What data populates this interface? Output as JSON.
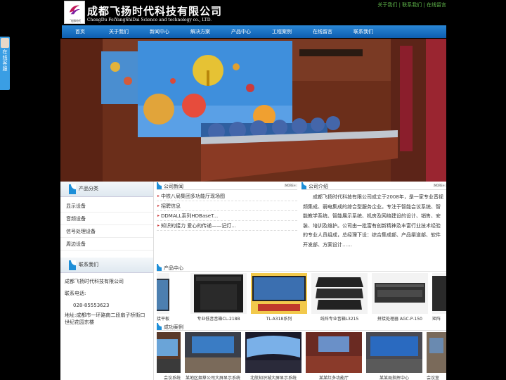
{
  "header": {
    "logo_small_text": "飞扬时代",
    "company_name": "成都飞扬时代科技有限公司",
    "company_en": "ChengDu FeiYangShiDai Science and technology co., LTD.",
    "top_links": "关于我们 | 联系我们 | 在线留言"
  },
  "nav": [
    "首页",
    "关于我们",
    "新闻中心",
    "解决方案",
    "产品中心",
    "工程案例",
    "在线留言",
    "联系我们"
  ],
  "side_float": {
    "label": "在线客服"
  },
  "left": {
    "product_category_title": "产品分类",
    "categories": [
      "显示设备",
      "音频设备",
      "信号处理设备",
      "周边设备"
    ],
    "contact_title": "联系我们",
    "contact_company": "成都飞扬时代科技有限公司",
    "contact_phone_label": "联系电话:",
    "contact_phone": "028-85553623",
    "contact_address": "地址:成都市一环路南二段扇子桥街口世纪花园东楼"
  },
  "news": {
    "title": "公司新闻",
    "more": "MORE+",
    "items": [
      "中铁八局集团多功能厅现场图",
      "招聘信息",
      "DDMALL系列HDBaseT...",
      "知识的接力 爱心的传递——记灯..."
    ]
  },
  "intro": {
    "title": "公司介绍",
    "more": "MORE+",
    "text": "成都飞扬时代科技有限公司成立于2008年，是一家专业音视频集成、弱电集成的综合型服务企业。专注于智能会议系统、智能教学系统、智能展示系统、机房及网络建设的设计、销售、安装、培训及维护。公司由一批富有创新精神及丰富行业技术经验的专业人员组成，总经理下设：综合集成部、产品渠道部、软件开发部、方案设计……"
  },
  "products": {
    "title": "产品中心",
    "items": [
      "液晶拼接平板",
      "专业低音音箱CL-218B",
      "TL-A318系列",
      "线阵专业音箱L3215",
      "拼接处理器 AGC-P-150",
      "矩阵"
    ]
  },
  "cases": {
    "title": "成功案例",
    "items": [
      "会议系统",
      "某地区烟草公司大屏显示系统",
      "北航知识城大屏显示系统",
      "某某红多功能厅",
      "某某局指挥中心",
      "会议室"
    ]
  },
  "colors": {
    "nav": "#1e74c8",
    "accent": "#1e8fd8",
    "top_links": "#5fb54a",
    "background": "#000000"
  }
}
